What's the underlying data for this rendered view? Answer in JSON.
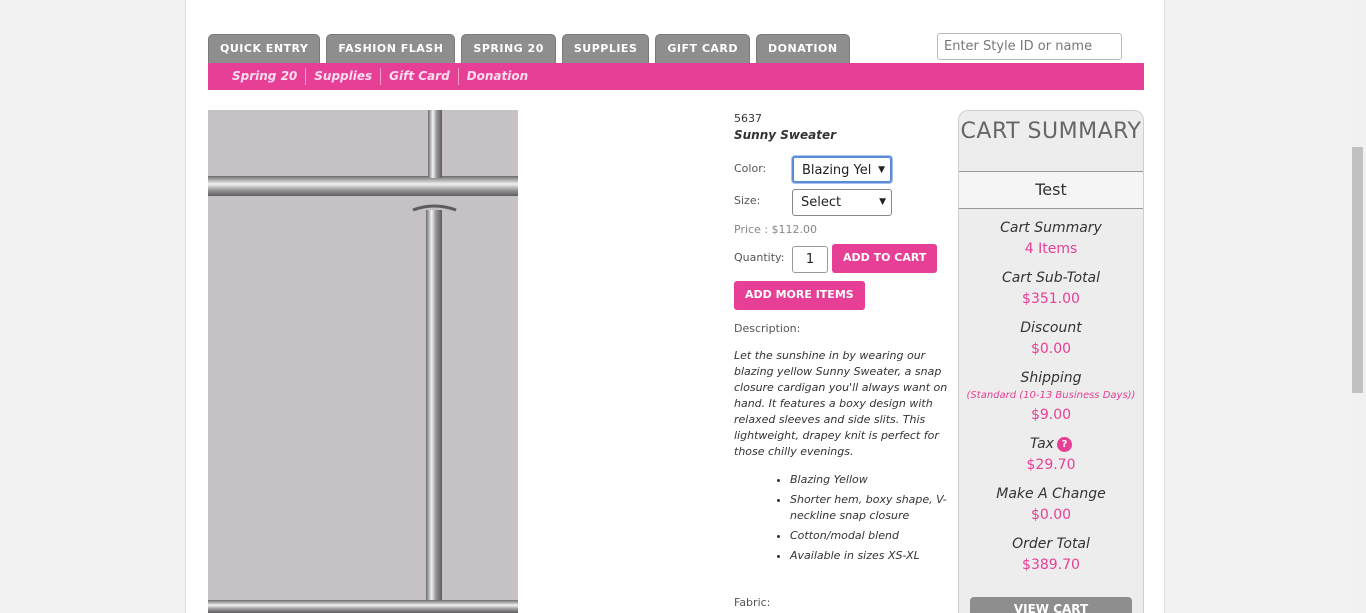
{
  "tabs": [
    {
      "label": "QUICK ENTRY"
    },
    {
      "label": "FASHION FLASH"
    },
    {
      "label": "SPRING 20"
    },
    {
      "label": "SUPPLIES"
    },
    {
      "label": "GIFT CARD"
    },
    {
      "label": "DONATION"
    }
  ],
  "search": {
    "placeholder": "Enter Style ID or name"
  },
  "subnav": [
    {
      "label": "Spring 20"
    },
    {
      "label": "Supplies"
    },
    {
      "label": "Gift Card"
    },
    {
      "label": "Donation"
    }
  ],
  "product": {
    "style_id": "5637",
    "name": "Sunny Sweater",
    "color_label": "Color:",
    "color_value": "Blazing Yel",
    "size_label": "Size:",
    "size_value": "Select",
    "price": "Price : $112.00",
    "quantity_label": "Quantity:",
    "quantity_value": "1",
    "add_to_cart": "ADD TO CART",
    "add_more": "ADD MORE ITEMS",
    "description_label": "Description:",
    "description": "Let the sunshine in by wearing our blazing yellow Sunny Sweater, a snap closure cardigan you'll always want on hand. It features a boxy design with relaxed sleeves and side slits. This lightweight, drapey knit is perfect for those chilly evenings.",
    "bullets": [
      "Blazing Yellow",
      "Shorter hem, boxy shape, V-neckline snap closure",
      "Cotton/modal blend",
      "Available in sizes XS-XL"
    ],
    "fabric_label": "Fabric:"
  },
  "cart": {
    "title": "CART SUMMARY",
    "user": "Test",
    "summary_label": "Cart Summary",
    "items": "4 Items",
    "subtotal_label": "Cart Sub-Total",
    "subtotal": "$351.00",
    "discount_label": "Discount",
    "discount": "$0.00",
    "shipping_label": "Shipping",
    "shipping_method": "(Standard (10-13 Business Days))",
    "shipping": "$9.00",
    "tax_label": "Tax",
    "tax_help": "?",
    "tax": "$29.70",
    "change_label": "Make A Change",
    "change": "$0.00",
    "total_label": "Order Total",
    "total": "$389.70",
    "view_cart": "VIEW CART"
  },
  "colors": {
    "accent": "#e73f95",
    "tab": "#8e8e8e"
  }
}
